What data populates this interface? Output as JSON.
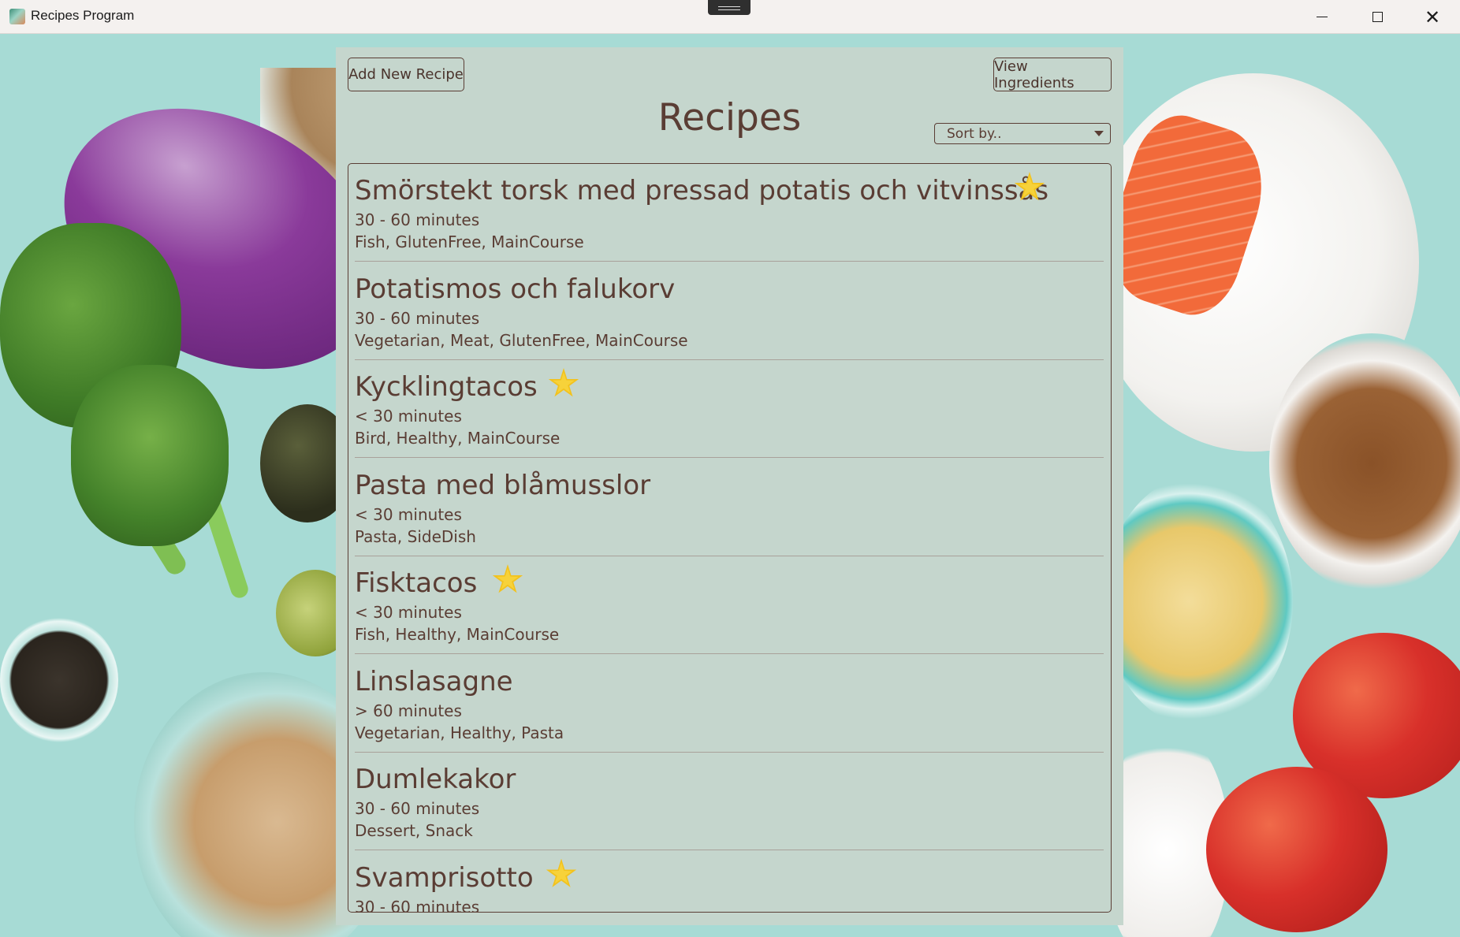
{
  "window": {
    "title": "Recipes Program",
    "icon": "recipes-app-icon"
  },
  "toolbar": {
    "add_label": "Add New Recipe",
    "view_label": "View Ingredients"
  },
  "header": {
    "title": "Recipes"
  },
  "sort": {
    "label": "Sort by.."
  },
  "colors": {
    "panel": "#c5d6cd",
    "text": "#5a3d34",
    "star": "#f2c21e",
    "background": "#a7dbd5"
  },
  "recipes": [
    {
      "name": "Smörstekt torsk med pressad potatis och vitvinssås",
      "time": "30 - 60 minutes",
      "tags": "Fish, GlutenFree, MainCourse",
      "favorite": true
    },
    {
      "name": "Potatismos och falukorv",
      "time": "30 - 60 minutes",
      "tags": "Vegetarian, Meat, GlutenFree, MainCourse",
      "favorite": false
    },
    {
      "name": "Kycklingtacos",
      "time": "< 30 minutes",
      "tags": "Bird, Healthy, MainCourse",
      "favorite": true
    },
    {
      "name": "Pasta med blåmusslor",
      "time": "< 30 minutes",
      "tags": "Pasta, SideDish",
      "favorite": false
    },
    {
      "name": "Fisktacos",
      "time": "< 30 minutes",
      "tags": "Fish, Healthy, MainCourse",
      "favorite": true
    },
    {
      "name": "Linslasagne",
      "time": "> 60 minutes",
      "tags": "Vegetarian, Healthy, Pasta",
      "favorite": false
    },
    {
      "name": "Dumlekakor",
      "time": "30 - 60 minutes",
      "tags": "Dessert, Snack",
      "favorite": false
    },
    {
      "name": "Svamprisotto",
      "time": "30 - 60 minutes",
      "tags": "",
      "favorite": true
    }
  ]
}
